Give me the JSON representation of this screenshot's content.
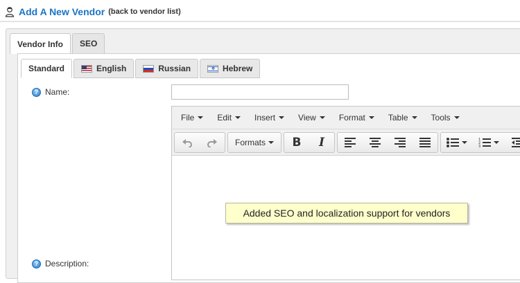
{
  "header": {
    "title": "Add A New Vendor",
    "back_open": "(",
    "back_link": "back to vendor list",
    "back_close": ")"
  },
  "tabs_outer": [
    {
      "label": "Vendor Info",
      "active": true
    },
    {
      "label": "SEO",
      "active": false
    }
  ],
  "tabs_inner": [
    {
      "label": "Standard",
      "active": true
    },
    {
      "label": "English",
      "flag": "us-flag"
    },
    {
      "label": "Russian",
      "flag": "ru-flag"
    },
    {
      "label": "Hebrew",
      "flag": "il-flag"
    }
  ],
  "fields": {
    "name_label": "Name:",
    "name_value": "",
    "description_label": "Description:"
  },
  "editor": {
    "menu": [
      "File",
      "Edit",
      "Insert",
      "View",
      "Format",
      "Table",
      "Tools"
    ],
    "formats_label": "Formats",
    "bold_glyph": "B",
    "italic_glyph": "I"
  },
  "tooltip": "Added SEO and localization support for vendors",
  "colors": {
    "title": "#1d73c6",
    "tooltip_bg": "#ffffcc"
  }
}
